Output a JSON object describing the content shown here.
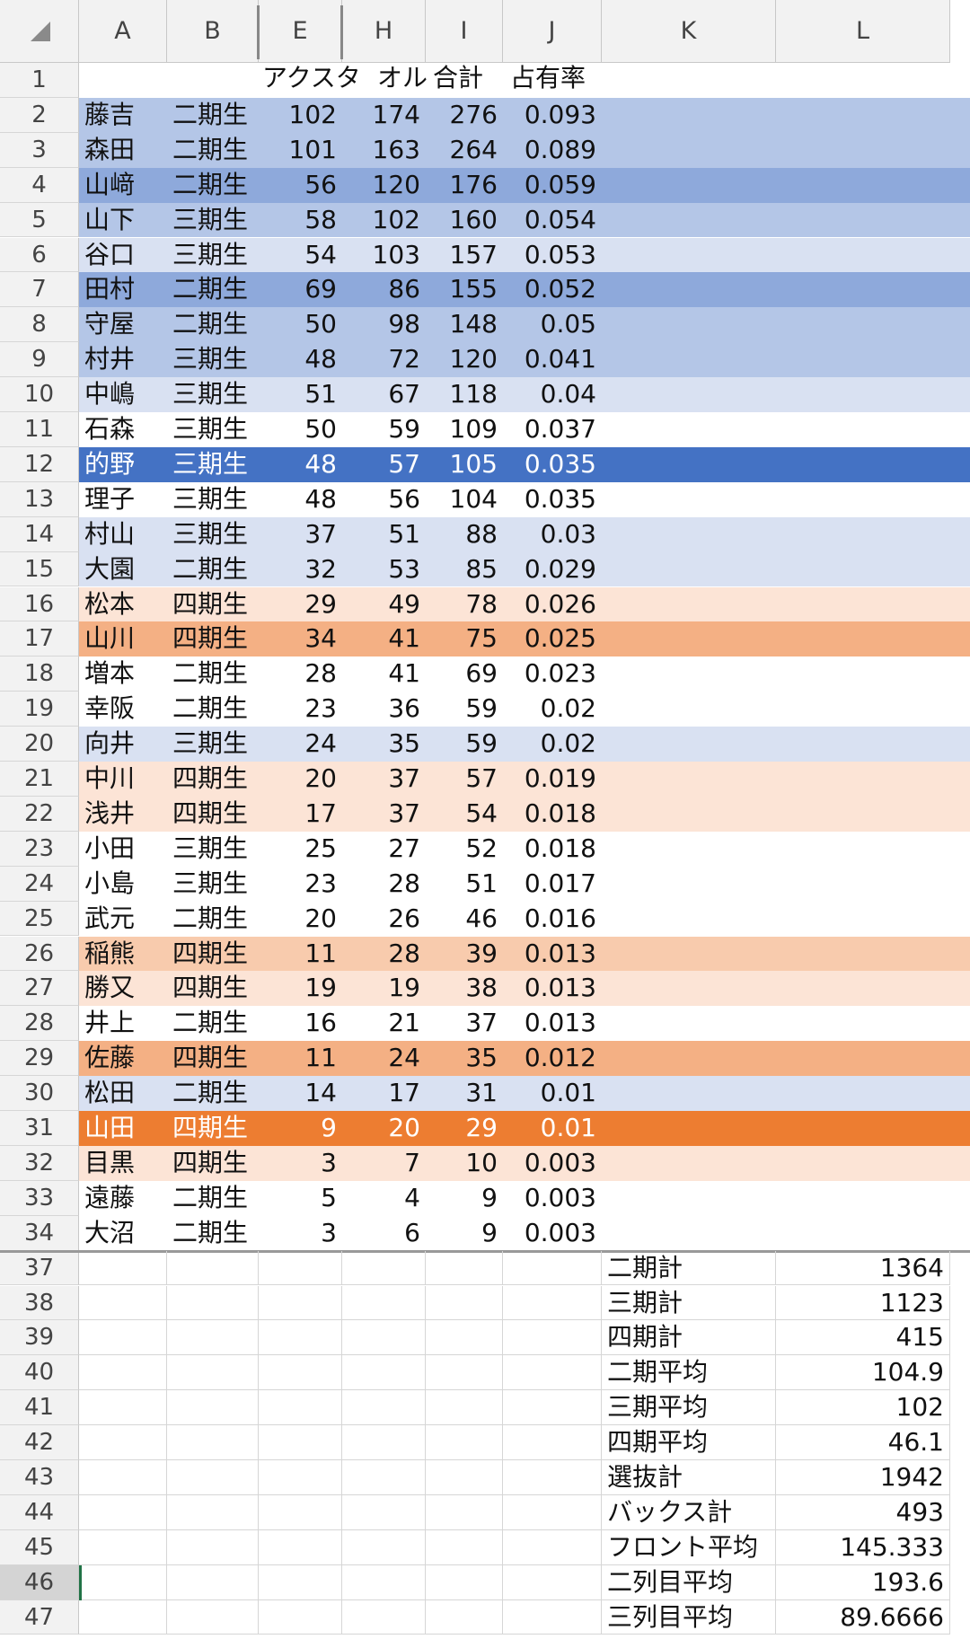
{
  "columns": [
    "A",
    "B",
    "E",
    "H",
    "I",
    "J",
    "K",
    "L"
  ],
  "header_row": {
    "row": "1",
    "text_acs": "アクスタ",
    "text_towel": "オル",
    "text_total": "合計",
    "text_share": "占有率"
  },
  "rows": [
    {
      "row": "2",
      "name": "藤吉",
      "gen": "二期生",
      "e": "102",
      "h": "174",
      "i": "276",
      "j": "0.093",
      "color": "#b4c6e7"
    },
    {
      "row": "3",
      "name": "森田",
      "gen": "二期生",
      "e": "101",
      "h": "163",
      "i": "264",
      "j": "0.089",
      "color": "#b4c6e7"
    },
    {
      "row": "4",
      "name": "山﨑",
      "gen": "二期生",
      "e": "56",
      "h": "120",
      "i": "176",
      "j": "0.059",
      "color": "#8ea9db"
    },
    {
      "row": "5",
      "name": "山下",
      "gen": "三期生",
      "e": "58",
      "h": "102",
      "i": "160",
      "j": "0.054",
      "color": "#b4c6e7"
    },
    {
      "row": "6",
      "name": "谷口",
      "gen": "三期生",
      "e": "54",
      "h": "103",
      "i": "157",
      "j": "0.053",
      "color": "#d9e1f2"
    },
    {
      "row": "7",
      "name": "田村",
      "gen": "二期生",
      "e": "69",
      "h": "86",
      "i": "155",
      "j": "0.052",
      "color": "#8ea9db"
    },
    {
      "row": "8",
      "name": "守屋",
      "gen": "二期生",
      "e": "50",
      "h": "98",
      "i": "148",
      "j": "0.05",
      "color": "#b4c6e7"
    },
    {
      "row": "9",
      "name": "村井",
      "gen": "三期生",
      "e": "48",
      "h": "72",
      "i": "120",
      "j": "0.041",
      "color": "#b4c6e7"
    },
    {
      "row": "10",
      "name": "中嶋",
      "gen": "三期生",
      "e": "51",
      "h": "67",
      "i": "118",
      "j": "0.04",
      "color": "#d9e1f2"
    },
    {
      "row": "11",
      "name": "石森",
      "gen": "三期生",
      "e": "50",
      "h": "59",
      "i": "109",
      "j": "0.037",
      "color": "#ffffff"
    },
    {
      "row": "12",
      "name": "的野",
      "gen": "三期生",
      "e": "48",
      "h": "57",
      "i": "105",
      "j": "0.035",
      "color": "#4472c4",
      "text": "#ffffff"
    },
    {
      "row": "13",
      "name": "理子",
      "gen": "三期生",
      "e": "48",
      "h": "56",
      "i": "104",
      "j": "0.035",
      "color": "#ffffff"
    },
    {
      "row": "14",
      "name": "村山",
      "gen": "三期生",
      "e": "37",
      "h": "51",
      "i": "88",
      "j": "0.03",
      "color": "#d9e1f2"
    },
    {
      "row": "15",
      "name": "大園",
      "gen": "二期生",
      "e": "32",
      "h": "53",
      "i": "85",
      "j": "0.029",
      "color": "#d9e1f2"
    },
    {
      "row": "16",
      "name": "松本",
      "gen": "四期生",
      "e": "29",
      "h": "49",
      "i": "78",
      "j": "0.026",
      "color": "#fce4d6"
    },
    {
      "row": "17",
      "name": "山川",
      "gen": "四期生",
      "e": "34",
      "h": "41",
      "i": "75",
      "j": "0.025",
      "color": "#f4b084"
    },
    {
      "row": "18",
      "name": "増本",
      "gen": "二期生",
      "e": "28",
      "h": "41",
      "i": "69",
      "j": "0.023",
      "color": "#ffffff"
    },
    {
      "row": "19",
      "name": "幸阪",
      "gen": "二期生",
      "e": "23",
      "h": "36",
      "i": "59",
      "j": "0.02",
      "color": "#ffffff"
    },
    {
      "row": "20",
      "name": "向井",
      "gen": "三期生",
      "e": "24",
      "h": "35",
      "i": "59",
      "j": "0.02",
      "color": "#d9e1f2"
    },
    {
      "row": "21",
      "name": "中川",
      "gen": "四期生",
      "e": "20",
      "h": "37",
      "i": "57",
      "j": "0.019",
      "color": "#fce4d6"
    },
    {
      "row": "22",
      "name": "浅井",
      "gen": "四期生",
      "e": "17",
      "h": "37",
      "i": "54",
      "j": "0.018",
      "color": "#fce4d6"
    },
    {
      "row": "23",
      "name": "小田",
      "gen": "三期生",
      "e": "25",
      "h": "27",
      "i": "52",
      "j": "0.018",
      "color": "#ffffff"
    },
    {
      "row": "24",
      "name": "小島",
      "gen": "三期生",
      "e": "23",
      "h": "28",
      "i": "51",
      "j": "0.017",
      "color": "#ffffff"
    },
    {
      "row": "25",
      "name": "武元",
      "gen": "二期生",
      "e": "20",
      "h": "26",
      "i": "46",
      "j": "0.016",
      "color": "#ffffff"
    },
    {
      "row": "26",
      "name": "稲熊",
      "gen": "四期生",
      "e": "11",
      "h": "28",
      "i": "39",
      "j": "0.013",
      "color": "#f8cbad"
    },
    {
      "row": "27",
      "name": "勝又",
      "gen": "四期生",
      "e": "19",
      "h": "19",
      "i": "38",
      "j": "0.013",
      "color": "#fce4d6"
    },
    {
      "row": "28",
      "name": "井上",
      "gen": "二期生",
      "e": "16",
      "h": "21",
      "i": "37",
      "j": "0.013",
      "color": "#ffffff"
    },
    {
      "row": "29",
      "name": "佐藤",
      "gen": "四期生",
      "e": "11",
      "h": "24",
      "i": "35",
      "j": "0.012",
      "color": "#f4b084"
    },
    {
      "row": "30",
      "name": "松田",
      "gen": "二期生",
      "e": "14",
      "h": "17",
      "i": "31",
      "j": "0.01",
      "color": "#d9e1f2"
    },
    {
      "row": "31",
      "name": "山田",
      "gen": "四期生",
      "e": "9",
      "h": "20",
      "i": "29",
      "j": "0.01",
      "color": "#ed7d31",
      "text": "#ffffff"
    },
    {
      "row": "32",
      "name": "目黒",
      "gen": "四期生",
      "e": "3",
      "h": "7",
      "i": "10",
      "j": "0.003",
      "color": "#fce4d6"
    },
    {
      "row": "33",
      "name": "遠藤",
      "gen": "二期生",
      "e": "5",
      "h": "4",
      "i": "9",
      "j": "0.003",
      "color": "#ffffff"
    },
    {
      "row": "34",
      "name": "大沼",
      "gen": "二期生",
      "e": "3",
      "h": "6",
      "i": "9",
      "j": "0.003",
      "color": "#ffffff"
    }
  ],
  "summary": [
    {
      "row": "37",
      "label": "二期計",
      "value": "1364"
    },
    {
      "row": "38",
      "label": "三期計",
      "value": "1123"
    },
    {
      "row": "39",
      "label": "四期計",
      "value": "415"
    },
    {
      "row": "40",
      "label": "二期平均",
      "value": "104.9"
    },
    {
      "row": "41",
      "label": "三期平均",
      "value": "102"
    },
    {
      "row": "42",
      "label": "四期平均",
      "value": "46.1"
    },
    {
      "row": "43",
      "label": "選抜計",
      "value": "1942"
    },
    {
      "row": "44",
      "label": "バックス計",
      "value": "493"
    },
    {
      "row": "45",
      "label": "フロント平均",
      "value": "145.333"
    },
    {
      "row": "46",
      "label": "二列目平均",
      "value": "193.6"
    },
    {
      "row": "47",
      "label": "三列目平均",
      "value": "89.6666"
    }
  ]
}
